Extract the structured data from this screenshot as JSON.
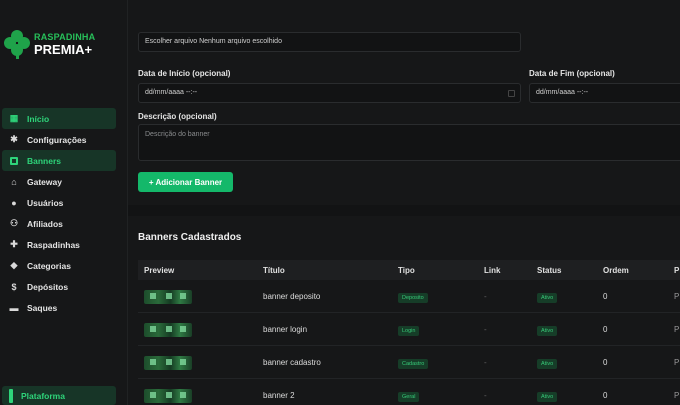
{
  "brand": {
    "line1": "RASPADINHA",
    "line2": "PREMIA+"
  },
  "sidebar": {
    "items": [
      {
        "label": "Início",
        "icon": "grid-icon",
        "active": true
      },
      {
        "label": "Configurações",
        "icon": "gear-icon",
        "active": false
      },
      {
        "label": "Banners",
        "icon": "image-icon",
        "active": true
      },
      {
        "label": "Gateway",
        "icon": "bank-icon",
        "active": false
      },
      {
        "label": "Usuários",
        "icon": "users-icon",
        "active": false
      },
      {
        "label": "Afiliados",
        "icon": "network-icon",
        "active": false
      },
      {
        "label": "Raspadinhas",
        "icon": "puzzle-icon",
        "active": false
      },
      {
        "label": "Categorias",
        "icon": "tag-icon",
        "active": false
      },
      {
        "label": "Depósitos",
        "icon": "dollar-icon",
        "active": false
      },
      {
        "label": "Saques",
        "icon": "wallet-icon",
        "active": false
      }
    ],
    "platform_label": "Plataforma"
  },
  "form": {
    "file_text": "Escolher arquivo Nenhum arquivo escolhido",
    "start_label": "Data de Início (opcional)",
    "start_value": "dd/mm/aaaa --:--",
    "end_label": "Data de Fim (opcional)",
    "end_value": "dd/mm/aaaa --:--",
    "desc_label": "Descrição (opcional)",
    "desc_placeholder": "Descrição do banner",
    "add_button": "+ Adicionar Banner"
  },
  "table": {
    "title": "Banners Cadastrados",
    "headers": [
      "Preview",
      "Título",
      "Tipo",
      "Link",
      "Status",
      "Ordem",
      "P"
    ],
    "rows": [
      {
        "title": "banner deposito",
        "type": "Deposito",
        "link": "-",
        "status": "Ativo",
        "order": "0",
        "edge": "P"
      },
      {
        "title": "banner login",
        "type": "Login",
        "link": "-",
        "status": "Ativo",
        "order": "0",
        "edge": "P"
      },
      {
        "title": "banner cadastro",
        "type": "Cadastro",
        "link": "-",
        "status": "Ativo",
        "order": "0",
        "edge": "P"
      },
      {
        "title": "banner 2",
        "type": "Geral",
        "link": "-",
        "status": "Ativo",
        "order": "0",
        "edge": "P"
      }
    ]
  },
  "colors": {
    "accent": "#14b86a",
    "active_bg": "#173527",
    "bg": "#121314"
  }
}
